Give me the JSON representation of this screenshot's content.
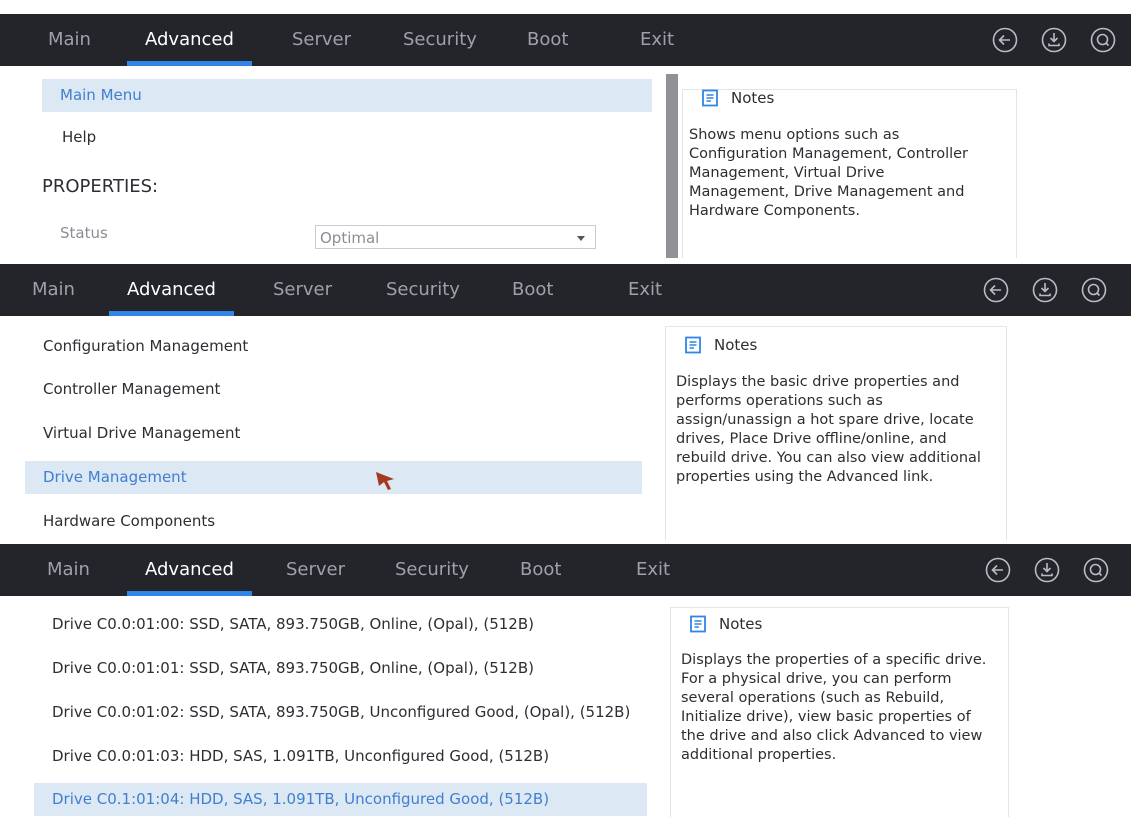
{
  "tabs": [
    "Main",
    "Advanced",
    "Server",
    "Security",
    "Boot",
    "Exit"
  ],
  "active_tab": "Advanced",
  "icons": [
    "back-icon",
    "save-icon",
    "search-icon"
  ],
  "accent_color": "#2f86e6",
  "selection_color": "#3f7fce",
  "panel1": {
    "menu": {
      "main_menu": "Main Menu",
      "help": "Help"
    },
    "properties_heading": "PROPERTIES:",
    "status_label": "Status",
    "status_value": "Optimal",
    "notes_title": "Notes",
    "notes_text": "Shows menu options such as Configuration Management, Controller Management, Virtual Drive Management, Drive Management and Hardware Components."
  },
  "panel2": {
    "items": [
      "Configuration Management",
      "Controller Management",
      "Virtual Drive Management",
      "Drive Management",
      "Hardware Components"
    ],
    "selected_index": 3,
    "notes_title": "Notes",
    "notes_text": "Displays the basic drive properties and performs operations such as assign/unassign a hot spare drive, locate drives, Place Drive offline/online, and rebuild drive. You can also view additional properties using the Advanced link."
  },
  "panel3": {
    "drives": [
      "Drive C0.0:01:00: SSD, SATA, 893.750GB, Online, (Opal), (512B)",
      "Drive C0.0:01:01: SSD, SATA, 893.750GB, Online, (Opal), (512B)",
      "Drive C0.0:01:02: SSD, SATA, 893.750GB, Unconfigured Good, (Opal), (512B)",
      "Drive C0.0:01:03: HDD, SAS, 1.091TB, Unconfigured Good, (512B)",
      "Drive C0.1:01:04: HDD, SAS, 1.091TB, Unconfigured Good, (512B)"
    ],
    "selected_index": 4,
    "notes_title": "Notes",
    "notes_text": "Displays the properties of a specific drive. For a physical drive, you can perform several operations (such as Rebuild, Initialize drive), view basic properties of the drive and also click Advanced to view additional properties."
  }
}
